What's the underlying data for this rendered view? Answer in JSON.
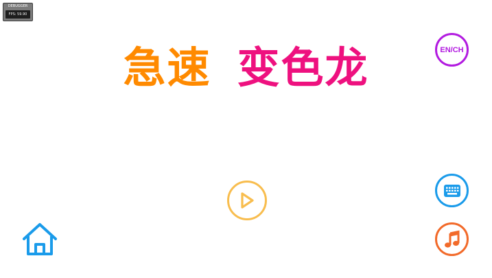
{
  "debugger": {
    "title": "DEBUGGER",
    "fps": "FPS: 59.90"
  },
  "title": {
    "part1": "急速",
    "part2": "变色龙",
    "part1_color": "#ff8a00",
    "part2_color": "#ee117f"
  },
  "controls": {
    "language_label": "EN/CH",
    "language_color": "#b21be0",
    "play_icon": "play-icon",
    "play_color": "#f8bd4e",
    "keyboard_icon": "keyboard-icon",
    "keyboard_color": "#1a9bea",
    "music_icon": "music-note-icon",
    "music_color": "#f26a2a",
    "home_icon": "home-icon",
    "home_color": "#1a9bea"
  }
}
